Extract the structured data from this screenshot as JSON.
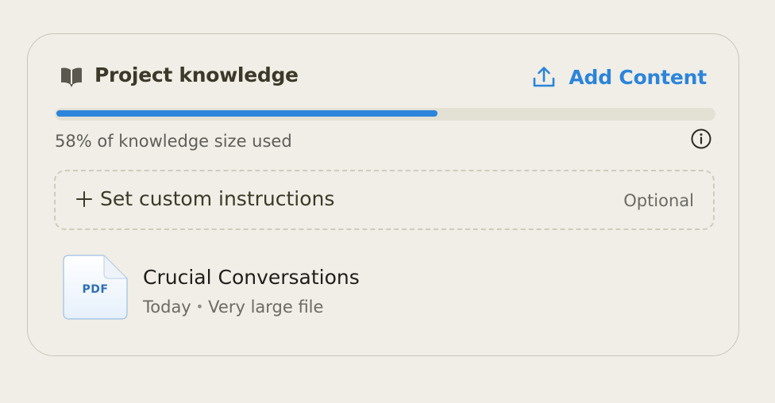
{
  "panel": {
    "title": "Project knowledge",
    "title_icon": "book-icon",
    "add_content": {
      "label": "Add Content",
      "icon": "upload-icon"
    }
  },
  "usage": {
    "percent": 58,
    "text": "58% of knowledge size used",
    "info_icon": "info-icon"
  },
  "instructions": {
    "label": "Set custom instructions",
    "optional": "Optional",
    "icon": "plus-icon"
  },
  "files": [
    {
      "name": "Crucial Conversations",
      "type": "PDF",
      "date": "Today",
      "size_note": "Very large file"
    }
  ],
  "colors": {
    "accent": "#2c84db",
    "background": "#f0eee6",
    "text": "#3d3929"
  }
}
